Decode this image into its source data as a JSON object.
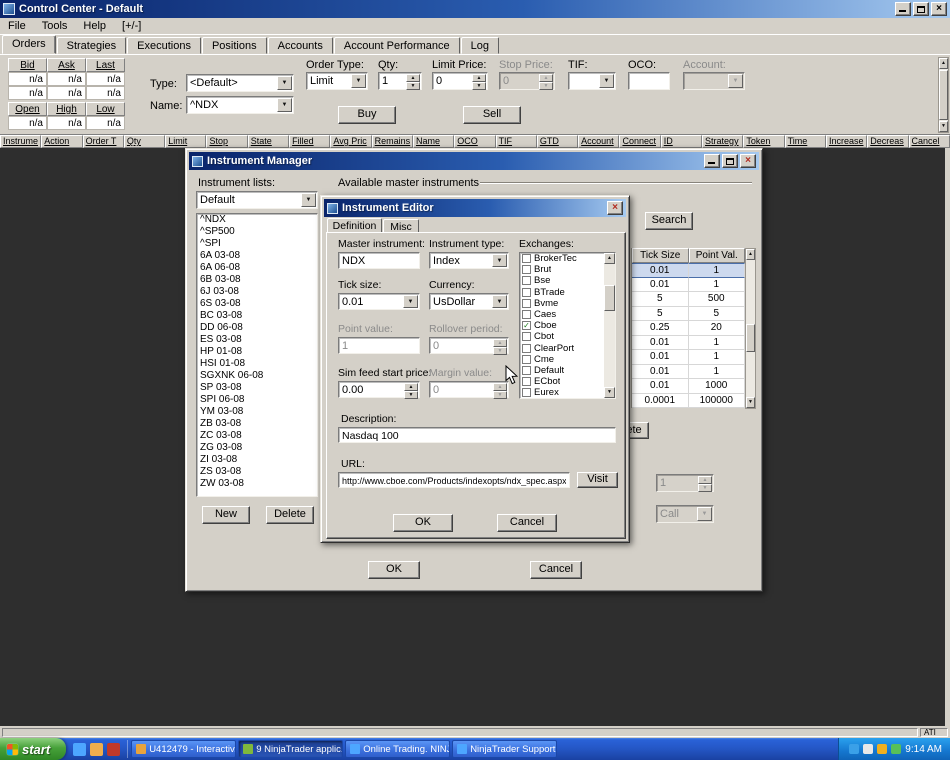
{
  "colors": {
    "titlebar_gradient_start": "#0a246a",
    "titlebar_gradient_end": "#a6caf0",
    "chrome": "#d4d0c8",
    "selection_blue": "#cdd9ee",
    "taskbar_blue": "#2456c4",
    "start_green": "#47a13a",
    "desktop_dark": "#2e2e2e"
  },
  "window": {
    "title": "Control Center - Default",
    "menu": [
      "File",
      "Tools",
      "Help",
      "[+/-]"
    ],
    "tabs": [
      "Orders",
      "Strategies",
      "Executions",
      "Positions",
      "Accounts",
      "Account Performance",
      "Log"
    ],
    "active_tab": "Orders"
  },
  "orders_panel": {
    "quote_headers1": [
      "Bid",
      "Ask",
      "Last"
    ],
    "quote_rows1": [
      [
        "n/a",
        "n/a",
        "n/a"
      ],
      [
        "n/a",
        "n/a",
        "n/a"
      ]
    ],
    "quote_headers2": [
      "Open",
      "High",
      "Low"
    ],
    "quote_rows2": [
      [
        "n/a",
        "n/a",
        "n/a"
      ]
    ],
    "type_label": "Type:",
    "type_value": "<Default>",
    "name_label": "Name:",
    "name_value": "^NDX",
    "order_type_label": "Order Type:",
    "order_type_value": "Limit",
    "qty_label": "Qty:",
    "qty_value": "1",
    "limit_price_label": "Limit Price:",
    "limit_price_value": "0",
    "stop_price_label": "Stop Price:",
    "stop_price_value": "0",
    "tif_label": "TIF:",
    "tif_value": "",
    "oco_label": "OCO:",
    "oco_value": "",
    "account_label": "Account:",
    "account_value": "",
    "buy_label": "Buy",
    "sell_label": "Sell"
  },
  "orders_grid": {
    "columns": [
      "Instrume",
      "Action",
      "Order T",
      "Qty",
      "Limit",
      "Stop",
      "State",
      "Filled",
      "Avg Pric",
      "Remains",
      "Name",
      "OCO",
      "TIF",
      "GTD",
      "Account",
      "Connect",
      "ID",
      "Strategy",
      "Token",
      "Time",
      "Increase",
      "Decreas",
      "Cancel"
    ]
  },
  "instrument_manager": {
    "title": "Instrument Manager",
    "lists_label": "Instrument lists:",
    "lists_value": "Default",
    "instruments": [
      "^NDX",
      "^SP500",
      "^SPI",
      "6A 03-08",
      "6A 06-08",
      "6B 03-08",
      "6J 03-08",
      "6S 03-08",
      "BC 03-08",
      "DD 06-08",
      "ES 03-08",
      "HP 01-08",
      "HSI 01-08",
      "SGXNK 06-08",
      "SP 03-08",
      "SPI 06-08",
      "YM 03-08",
      "ZB 03-08",
      "ZC 03-08",
      "ZG 03-08",
      "ZI 03-08",
      "ZS 03-08",
      "ZW 03-08"
    ],
    "new_label": "New",
    "delete_label": "Delete",
    "available_label": "Available master instruments",
    "search_label": "Search",
    "table": {
      "columns": [
        "Tick Size",
        "Point Val."
      ],
      "rows": [
        [
          "0.01",
          "1"
        ],
        [
          "0.01",
          "1"
        ],
        [
          "5",
          "500"
        ],
        [
          "5",
          "5"
        ],
        [
          "0.25",
          "20"
        ],
        [
          "0.01",
          "1"
        ],
        [
          "0.01",
          "1"
        ],
        [
          "0.01",
          "1"
        ],
        [
          "0.01",
          "1000"
        ],
        [
          "0.0001",
          "100000"
        ]
      ]
    },
    "ete_label": "ete",
    "spinner_value": "1",
    "call_value": "Call",
    "ok_label": "OK",
    "cancel_label": "Cancel"
  },
  "instrument_editor": {
    "title": "Instrument Editor",
    "tabs": [
      "Definition",
      "Misc"
    ],
    "active_tab": "Definition",
    "master_instrument_label": "Master instrument:",
    "master_instrument_value": "NDX",
    "instrument_type_label": "Instrument type:",
    "instrument_type_value": "Index",
    "exchanges_label": "Exchanges:",
    "exchanges": [
      {
        "name": "BrokerTec",
        "checked": false
      },
      {
        "name": "Brut",
        "checked": false
      },
      {
        "name": "Bse",
        "checked": false
      },
      {
        "name": "BTrade",
        "checked": false
      },
      {
        "name": "Bvme",
        "checked": false
      },
      {
        "name": "Caes",
        "checked": false
      },
      {
        "name": "Cboe",
        "checked": true
      },
      {
        "name": "Cbot",
        "checked": false
      },
      {
        "name": "ClearPort",
        "checked": false
      },
      {
        "name": "Cme",
        "checked": false
      },
      {
        "name": "Default",
        "checked": false
      },
      {
        "name": "ECbot",
        "checked": false
      },
      {
        "name": "Eurex",
        "checked": false
      }
    ],
    "tick_size_label": "Tick size:",
    "tick_size_value": "0.01",
    "currency_label": "Currency:",
    "currency_value": "UsDollar",
    "point_value_label": "Point value:",
    "point_value_value": "1",
    "rollover_label": "Rollover period:",
    "rollover_value": "0",
    "sim_feed_label": "Sim feed start price:",
    "sim_feed_value": "0.00",
    "margin_label": "Margin value:",
    "margin_value": "0",
    "description_label": "Description:",
    "description_value": "Nasdaq 100",
    "url_label": "URL:",
    "url_value": "http://www.cboe.com/Products/indexopts/ndx_spec.aspx",
    "visit_label": "Visit",
    "ok_label": "OK",
    "cancel_label": "Cancel"
  },
  "status": {
    "ati_label": "ATI"
  },
  "taskbar": {
    "start_label": "start",
    "tasks": [
      "U412479 - Interactiv...",
      "9 NinjaTrader applic...",
      "Online Trading. NINJ...",
      "NinjaTrader Support ..."
    ],
    "time": "9:14 AM"
  }
}
